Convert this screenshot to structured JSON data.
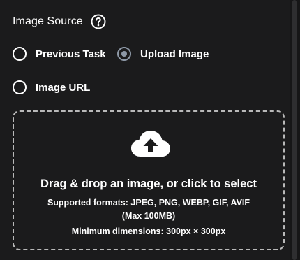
{
  "image_source": {
    "title": "Image Source",
    "help_icon": "question-circle-icon",
    "options": [
      {
        "label": "Previous Task",
        "selected": false
      },
      {
        "label": "Upload Image",
        "selected": true
      },
      {
        "label": "Image URL",
        "selected": false
      }
    ]
  },
  "dropzone": {
    "icon": "cloud-upload-icon",
    "title": "Drag & drop an image, or click to select",
    "formats_line1": "Supported formats: JPEG, PNG, WEBP, GIF, AVIF",
    "formats_line2": "(Max 100MB)",
    "min_dimensions": "Minimum dimensions: 300px × 300px"
  },
  "colors": {
    "background": "#1b1b1c",
    "text": "#ffffff",
    "selected_radio": "#8d98a6",
    "dashed_border": "#b9b9b9"
  }
}
